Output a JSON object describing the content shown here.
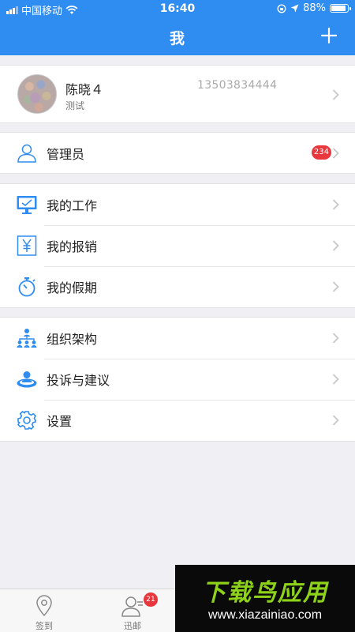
{
  "status_bar": {
    "carrier": "中国移动",
    "time": "16:40",
    "battery": "88%"
  },
  "header": {
    "title": "我",
    "plus_icon": "plus-icon"
  },
  "profile": {
    "name": "陈晓４",
    "subtitle": "测试",
    "phone": "13503834444"
  },
  "admin": {
    "label": "管理员",
    "badge": "234",
    "icon": "person-icon"
  },
  "work_group": [
    {
      "label": "我的工作",
      "icon": "monitor-icon"
    },
    {
      "label": "我的报销",
      "icon": "yen-icon"
    },
    {
      "label": "我的假期",
      "icon": "stopwatch-icon"
    }
  ],
  "org_group": [
    {
      "label": "组织架构",
      "icon": "org-chart-icon"
    },
    {
      "label": "投诉与建议",
      "icon": "feedback-icon"
    },
    {
      "label": "设置",
      "icon": "gear-icon"
    }
  ],
  "tabbar": {
    "tabs": [
      {
        "label": "签到",
        "icon": "location-pin-icon"
      },
      {
        "label": "迅邮",
        "icon": "contacts-icon",
        "badge": "21"
      }
    ]
  },
  "watermark": {
    "title": "下载鸟应用",
    "url": "www.xiazainiao.com"
  },
  "colors": {
    "header_bg": "#2f8cf0",
    "badge": "#e8383d",
    "icon_blue": "#2f8cf0"
  }
}
